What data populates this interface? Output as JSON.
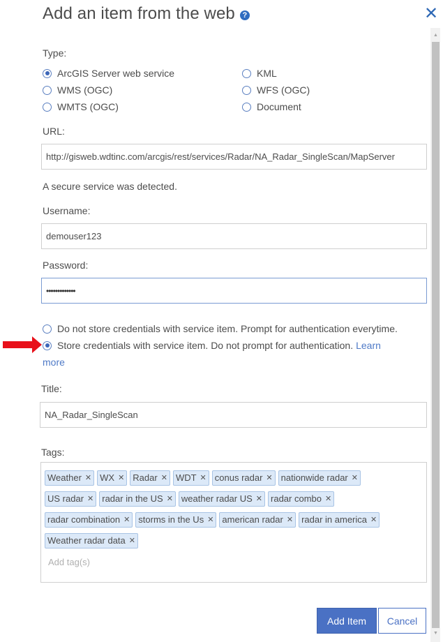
{
  "dialog": {
    "title": "Add an item from the web",
    "help_icon": "?",
    "close_icon": "✕"
  },
  "type": {
    "label": "Type:",
    "options": [
      {
        "label": "ArcGIS Server web service",
        "checked": true
      },
      {
        "label": "KML",
        "checked": false
      },
      {
        "label": "WMS (OGC)",
        "checked": false
      },
      {
        "label": "WFS (OGC)",
        "checked": false
      },
      {
        "label": "WMTS (OGC)",
        "checked": false
      },
      {
        "label": "Document",
        "checked": false
      }
    ]
  },
  "url": {
    "label": "URL:",
    "value": "http://gisweb.wdtinc.com/arcgis/rest/services/Radar/NA_Radar_SingleScan/MapServer"
  },
  "secure_notice": "A secure service was detected.",
  "username": {
    "label": "Username:",
    "value": "demouser123"
  },
  "password": {
    "label": "Password:",
    "value": "•••••••••••••"
  },
  "credentials": {
    "options": [
      {
        "label": "Do not store credentials with service item. Prompt for authentication everytime.",
        "checked": false
      },
      {
        "label": "Store credentials with service item. Do not prompt for authentication.",
        "checked": true
      }
    ],
    "learn_more_a": "Learn",
    "learn_more_b": "more"
  },
  "title_field": {
    "label": "Title:",
    "value": "NA_Radar_SingleScan"
  },
  "tags": {
    "label": "Tags:",
    "items": [
      [
        "Weather",
        "WX",
        "Radar",
        "WDT",
        "conus radar",
        "nationwide radar"
      ],
      [
        "US radar",
        "radar in the US",
        "weather radar US",
        "radar combo"
      ],
      [
        "radar combination",
        "storms in the Us",
        "american radar",
        "radar in america"
      ],
      [
        "Weather radar data"
      ]
    ],
    "remove_glyph": "✕",
    "placeholder": "Add tag(s)"
  },
  "buttons": {
    "add_item": "Add Item",
    "cancel": "Cancel"
  },
  "colors": {
    "accent": "#4a71c4",
    "annotation_arrow": "#e8101a"
  }
}
